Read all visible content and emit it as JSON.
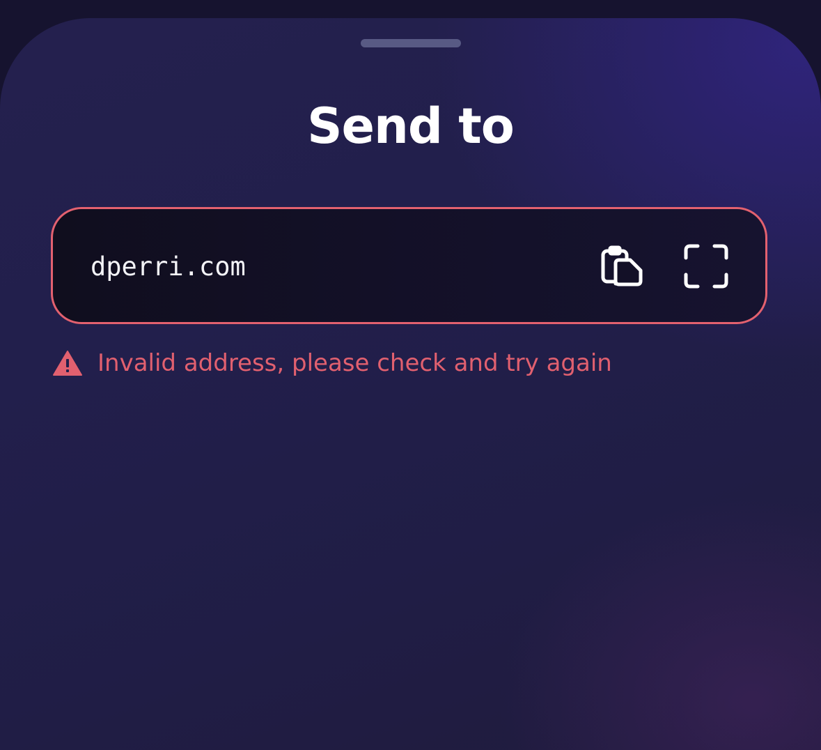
{
  "sheet": {
    "title": "Send to"
  },
  "address_field": {
    "value": "dperri.com"
  },
  "actions": {
    "paste_icon": "clipboard-paste-icon",
    "scan_icon": "qr-scan-icon"
  },
  "error": {
    "icon": "warning-triangle-icon",
    "message": "Invalid address, please check and try again"
  },
  "colors": {
    "error": "#e1606f",
    "text": "#ffffff",
    "background": "#221f4c"
  }
}
